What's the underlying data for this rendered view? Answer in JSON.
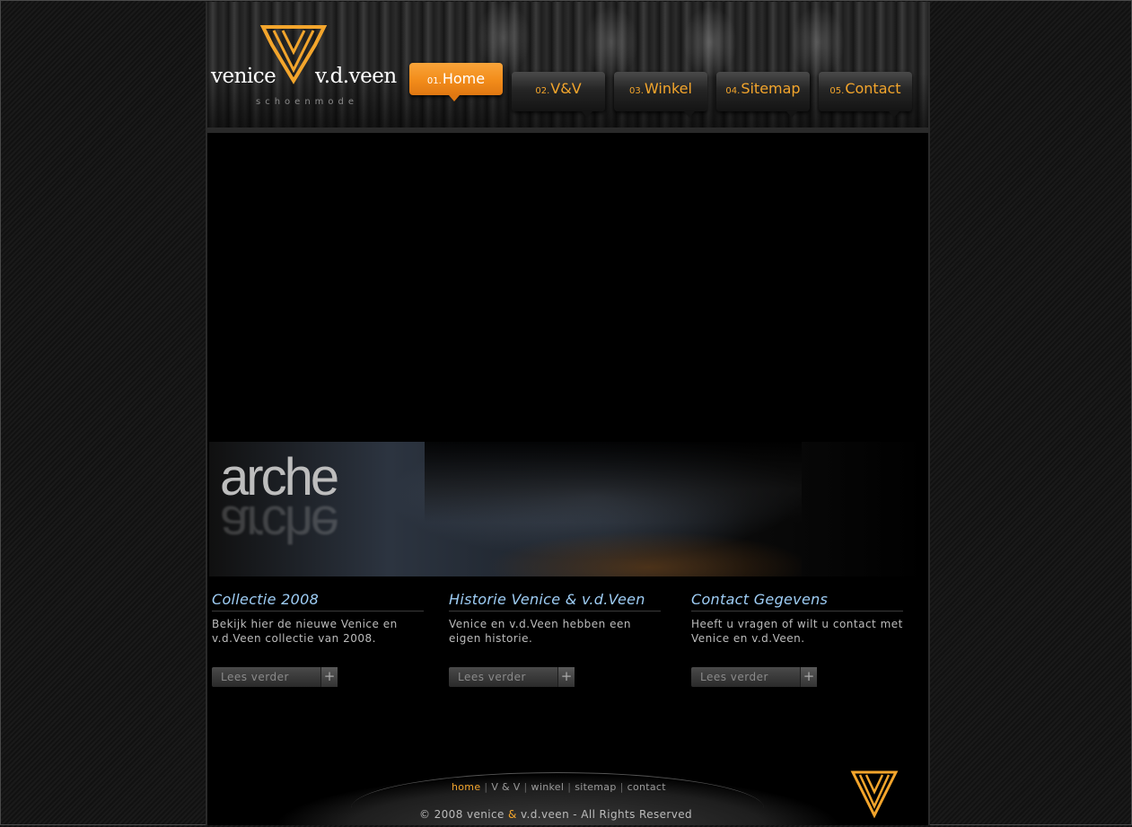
{
  "logo": {
    "left": "venice",
    "right": "v.d.veen",
    "sub": "schoenmode"
  },
  "nav": [
    {
      "num": "01.",
      "label": "Home",
      "active": true
    },
    {
      "num": "02.",
      "label": "V&V",
      "active": false
    },
    {
      "num": "03.",
      "label": "Winkel",
      "active": false
    },
    {
      "num": "04.",
      "label": "Sitemap",
      "active": false
    },
    {
      "num": "05.",
      "label": "Contact",
      "active": false
    }
  ],
  "banner": {
    "word": "arche"
  },
  "columns": [
    {
      "title": "Collectie 2008",
      "text": "Bekijk hier de nieuwe Venice en v.d.Veen collectie van 2008.",
      "button": "Lees verder"
    },
    {
      "title": "Historie Venice & v.d.Veen",
      "text": "Venice en v.d.Veen hebben een eigen historie.",
      "button": "Lees verder"
    },
    {
      "title": "Contact Gegevens",
      "text": "Heeft u vragen of wilt u contact met Venice en v.d.Veen.",
      "button": "Lees verder"
    }
  ],
  "footer": {
    "links": [
      "home",
      "V & V",
      "winkel",
      "sitemap",
      "contact"
    ],
    "separator": "|",
    "copyright_pre": "© 2008 venice",
    "copyright_amp": "&",
    "copyright_post": "v.d.veen - All Rights Reserved"
  },
  "colors": {
    "accent": "#f3a52c",
    "heading": "#9ecdf5",
    "background": "#000000"
  },
  "icons": {
    "button_plus": "plus-icon",
    "logo": "vv-monogram-icon"
  }
}
